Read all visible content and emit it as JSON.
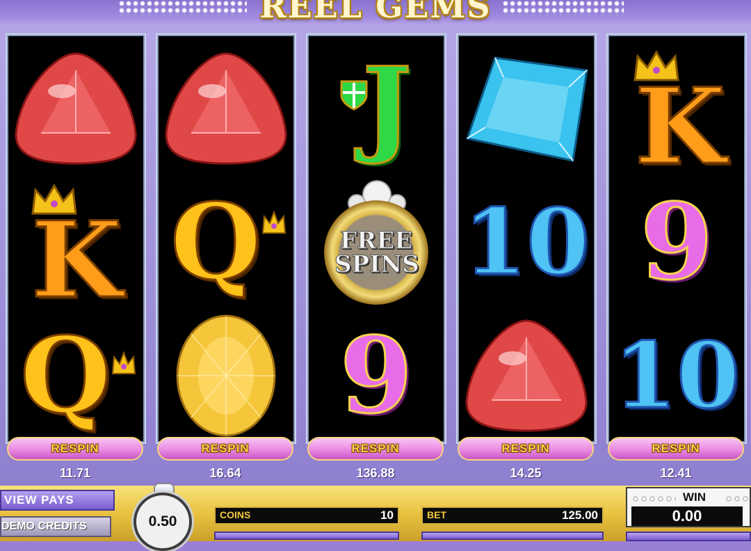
{
  "title": "REEL GEMS",
  "reels": [
    {
      "symbols": [
        {
          "icon": "red-trillion-gem-icon",
          "label": ""
        },
        {
          "icon": "king-crown-icon",
          "label": "K"
        },
        {
          "icon": "queen-crown-icon",
          "label": "Q"
        }
      ],
      "respin_label": "RESPIN",
      "respin_cost": "11.71"
    },
    {
      "symbols": [
        {
          "icon": "red-trillion-gem-icon",
          "label": ""
        },
        {
          "icon": "queen-crown-icon",
          "label": "Q"
        },
        {
          "icon": "yellow-oval-gem-icon",
          "label": ""
        }
      ],
      "respin_label": "RESPIN",
      "respin_cost": "16.64"
    },
    {
      "symbols": [
        {
          "icon": "jack-shield-icon",
          "label": "J"
        },
        {
          "icon": "free-spins-ring-icon",
          "label": "FREE SPINS"
        },
        {
          "icon": "nine-icon",
          "label": "9"
        }
      ],
      "respin_label": "RESPIN",
      "respin_cost": "136.88"
    },
    {
      "symbols": [
        {
          "icon": "blue-square-gem-icon",
          "label": ""
        },
        {
          "icon": "ten-icon",
          "label": "10"
        },
        {
          "icon": "red-trillion-gem-icon",
          "label": ""
        }
      ],
      "respin_label": "RESPIN",
      "respin_cost": "14.25"
    },
    {
      "symbols": [
        {
          "icon": "king-crown-icon",
          "label": "K"
        },
        {
          "icon": "nine-icon",
          "label": "9"
        },
        {
          "icon": "ten-icon",
          "label": "10"
        }
      ],
      "respin_label": "RESPIN",
      "respin_cost": "12.41"
    }
  ],
  "controls": {
    "view_pays": "VIEW PAYS",
    "demo_credits": "DEMO CREDITS",
    "coin_value": "0.50",
    "coins_label": "COINS",
    "coins_value": "10",
    "bet_label": "BET",
    "bet_value": "125.00",
    "win_label": "WIN",
    "win_value": "0.00"
  },
  "colors": {
    "respin_pink": "#e98ae2",
    "gold": "#f6d77a",
    "background_purple": "#8f7fd0"
  }
}
